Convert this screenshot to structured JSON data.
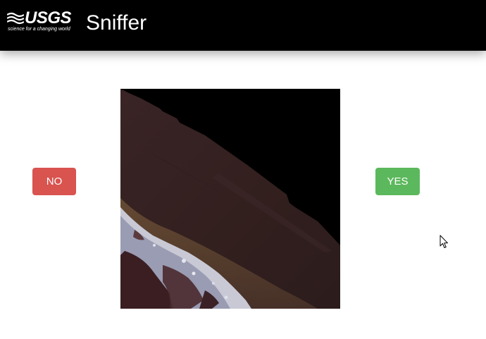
{
  "header": {
    "logo": {
      "wordmark": "USGS",
      "tagline": "science for a changing world"
    },
    "title": "Sniffer"
  },
  "actions": {
    "no_label": "NO",
    "yes_label": "YES"
  },
  "colors": {
    "header_bg": "#000000",
    "no_button": "#d9534f",
    "yes_button": "#5cb85c"
  },
  "icons": {
    "logo_mark": "usgs-wave-icon",
    "cursor": "mouse-pointer-icon"
  }
}
